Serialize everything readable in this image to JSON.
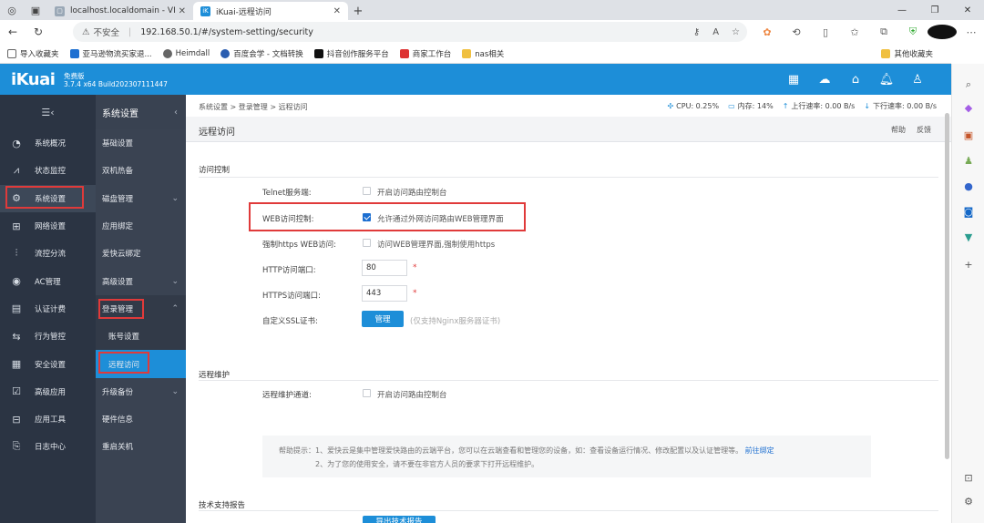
{
  "browser": {
    "tabs": [
      {
        "title": "localhost.localdomain - VMware",
        "active": false
      },
      {
        "title": "iKuai-远程访问",
        "active": true
      }
    ],
    "new_tab": "+",
    "url_warning": "不安全",
    "url": "192.168.50.1/#/system-setting/security"
  },
  "bookmarks": [
    {
      "label": "导入收藏夹"
    },
    {
      "label": "亚马逊物流买家退..."
    },
    {
      "label": "Heimdall"
    },
    {
      "label": "百度会学 - 文档转换"
    },
    {
      "label": "抖音创作服务平台"
    },
    {
      "label": "商家工作台"
    },
    {
      "label": "nas相关"
    }
  ],
  "bookmarks_other": "其他收藏夹",
  "app": {
    "logo": "iKuai",
    "edition": "免费版",
    "version": "3.7.4 x64 Build202307111447"
  },
  "leftnav": [
    {
      "label": "系统概况",
      "icon": "dashboard-icon"
    },
    {
      "label": "状态监控",
      "icon": "monitor-icon"
    },
    {
      "label": "系统设置",
      "icon": "gear-icon",
      "active": true
    },
    {
      "label": "网络设置",
      "icon": "network-icon"
    },
    {
      "label": "流控分流",
      "icon": "traffic-icon"
    },
    {
      "label": "AC管理",
      "icon": "ac-icon"
    },
    {
      "label": "认证计费",
      "icon": "auth-icon"
    },
    {
      "label": "行为管控",
      "icon": "behavior-icon"
    },
    {
      "label": "安全设置",
      "icon": "security-icon"
    },
    {
      "label": "高级应用",
      "icon": "advanced-icon"
    },
    {
      "label": "应用工具",
      "icon": "tools-icon"
    },
    {
      "label": "日志中心",
      "icon": "log-icon"
    }
  ],
  "secnav": {
    "title": "系统设置",
    "items": [
      {
        "label": "基础设置"
      },
      {
        "label": "双机热备"
      },
      {
        "label": "磁盘管理"
      },
      {
        "label": "应用绑定"
      },
      {
        "label": "爱快云绑定"
      },
      {
        "label": "高级设置"
      },
      {
        "label": "登录管理"
      },
      {
        "label": "账号设置"
      },
      {
        "label": "远程访问"
      },
      {
        "label": "升级备份"
      },
      {
        "label": "硬件信息"
      },
      {
        "label": "重启关机"
      }
    ]
  },
  "main": {
    "breadcrumb": "系统设置 > 登录管理 > 远程访问",
    "stats": {
      "cpu": "CPU: 0.25%",
      "mem": "内存: 14%",
      "up": "上行速率: 0.00 B/s",
      "down": "下行速率: 0.00 B/s"
    },
    "page_title": "远程访问",
    "help": "帮助",
    "feedback": "反馈",
    "section_access": "访问控制",
    "telnet_label": "Telnet服务端:",
    "telnet_text": "开启访问路由控制台",
    "web_label": "WEB访问控制:",
    "web_text": "允许通过外网访问路由WEB管理界面",
    "https_label": "强制https WEB访问:",
    "https_text": "访问WEB管理界面,强制使用https",
    "http_port_label": "HTTP访问端口:",
    "http_port": "80",
    "https_port_label": "HTTPS访问端口:",
    "https_port": "443",
    "required_mark": "*",
    "ssl_label": "自定义SSL证书:",
    "ssl_button": "管理",
    "ssl_hint": "(仅支持Nginx服务器证书)",
    "section_remote": "远程维护",
    "remote_label": "远程维护通道:",
    "remote_text": "开启访问路由控制台",
    "tip_line1": "帮助提示：1、爱快云是集中管理爱快路由的云端平台，您可以在云端查看和管理您的设备，如：查看设备运行情况、修改配置以及认证管理等。",
    "tip_link": "前往绑定",
    "tip_line2": "2、为了您的使用安全，请不要在非官方人员的要求下打开远程维护。",
    "section_support": "技术支持报告",
    "support_button": "导出技术报告"
  }
}
